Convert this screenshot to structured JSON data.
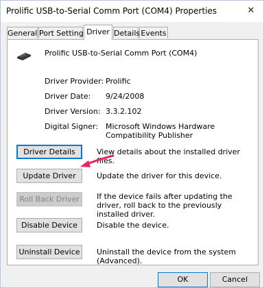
{
  "window": {
    "title": "Prolific USB-to-Serial Comm Port (COM4) Properties",
    "close_glyph": "✕"
  },
  "tabs": [
    {
      "label": "General"
    },
    {
      "label": "Port Settings"
    },
    {
      "label": "Driver",
      "active": true
    },
    {
      "label": "Details"
    },
    {
      "label": "Events"
    }
  ],
  "device": {
    "icon": "usb-serial-device-icon",
    "name": "Prolific USB-to-Serial Comm Port (COM4)"
  },
  "properties": {
    "provider_label": "Driver Provider:",
    "provider_value": "Prolific",
    "date_label": "Driver Date:",
    "date_value": "9/24/2008",
    "version_label": "Driver Version:",
    "version_value": "3.3.2.102",
    "signer_label": "Digital Signer:",
    "signer_value": "Microsoft Windows Hardware Compatibility Publisher"
  },
  "actions": {
    "details_label": "Driver Details",
    "details_desc": "View details about the installed driver files.",
    "update_label": "Update Driver",
    "update_desc": "Update the driver for this device.",
    "rollback_label": "Roll Back Driver",
    "rollback_desc": "If the device fails after updating the driver, roll back to the previously installed driver.",
    "disable_label": "Disable Device",
    "disable_desc": "Disable the device.",
    "uninstall_label": "Uninstall Device",
    "uninstall_desc": "Uninstall the device from the system (Advanced)."
  },
  "footer": {
    "ok_label": "OK",
    "cancel_label": "Cancel"
  },
  "colors": {
    "accent": "#0078d7",
    "annotation_arrow": "#e8246a",
    "disabled_button": "#cccccc"
  }
}
